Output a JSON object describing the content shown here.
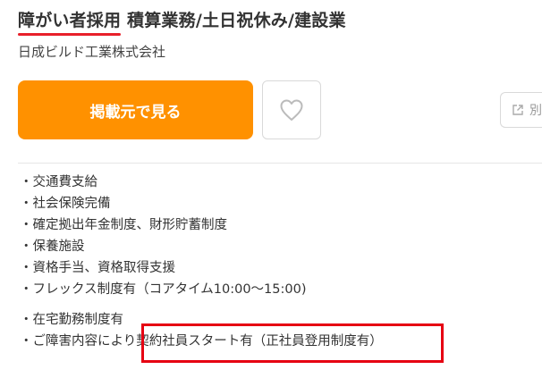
{
  "job": {
    "tag": "障がい者採用",
    "title": "積算業務/土日祝休み/建設業",
    "company": "日成ビルド工業株式会社"
  },
  "actions": {
    "primary_label": "掲載元で見る",
    "favorite_icon": "heart-icon",
    "newtab_icon": "external-link-icon",
    "newtab_label": "別"
  },
  "benefits": [
    "・交通費支給",
    "・社会保険完備",
    "・確定拠出年金制度、財形貯蓄制度",
    "・保養施設",
    "・資格手当、資格取得支援",
    "・フレックス制度有（コアタイム10:00～15:00)",
    "・在宅勤務制度有",
    "・ご障害内容により契約社員スタート有（正社員登用制度有）"
  ],
  "colors": {
    "accent_orange": "#ff9100",
    "underline_red": "#e8202a",
    "highlight_red": "#e60012"
  }
}
